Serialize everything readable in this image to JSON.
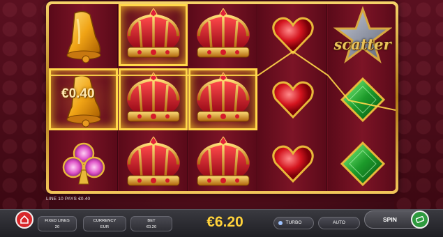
{
  "reels": {
    "amount_label": "€0.40",
    "scatter_label": "scatter"
  },
  "bottom": {
    "win_info": "LINE 10 PAYS €0.40",
    "fixed_lines_label": "FIXED LINES",
    "fixed_lines_value": "20",
    "currency_label": "CURRENCY",
    "currency_value": "EUR",
    "bet_label": "BET",
    "bet_value": "€0.20",
    "balance": "€6.20",
    "turbo_label": "TURBO",
    "auto_label": "AUTO",
    "spin_label": "SPIN"
  },
  "symbols": [
    [
      "bell",
      "bell",
      "clover"
    ],
    [
      "crown",
      "crown",
      "crown"
    ],
    [
      "crown",
      "crown",
      "crown"
    ],
    [
      "heart",
      "heart",
      "heart"
    ],
    [
      "scatter-star",
      "emerald",
      "emerald"
    ]
  ],
  "colors": {
    "gold": "#f6c845",
    "win_glow": "#ffd84a",
    "balance": "#ffd23a",
    "spin_green": "#2e9a3e",
    "home_red": "#d8282b"
  }
}
